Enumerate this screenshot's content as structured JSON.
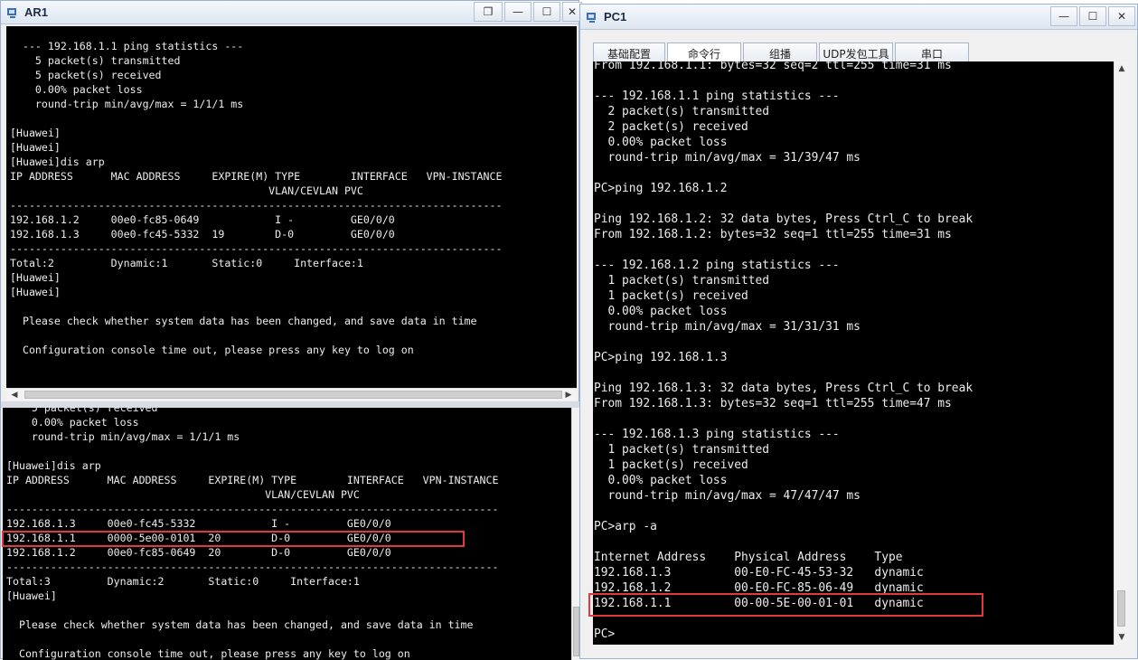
{
  "ar1": {
    "title": "AR1",
    "buttons": {
      "restore": "❐",
      "minimize": "—",
      "maximize": "☐",
      "close": "✕"
    },
    "top_console": [
      "  --- 192.168.1.1 ping statistics ---",
      "    5 packet(s) transmitted",
      "    5 packet(s) received",
      "    0.00% packet loss",
      "    round-trip min/avg/max = 1/1/1 ms",
      "",
      "[Huawei]",
      "[Huawei]",
      "[Huawei]dis arp",
      "IP ADDRESS      MAC ADDRESS     EXPIRE(M) TYPE        INTERFACE   VPN-INSTANCE",
      "                                         VLAN/CEVLAN PVC",
      "------------------------------------------------------------------------------",
      "192.168.1.2     00e0-fc85-0649            I -         GE0/0/0",
      "192.168.1.3     00e0-fc45-5332  19        D-0         GE0/0/0",
      "------------------------------------------------------------------------------",
      "Total:2         Dynamic:1       Static:0     Interface:1",
      "[Huawei]",
      "[Huawei]",
      "",
      "  Please check whether system data has been changed, and save data in time",
      "",
      "  Configuration console time out, please press any key to log on"
    ],
    "bottom_console": [
      "    5 packet(s) received",
      "    0.00% packet loss",
      "    round-trip min/avg/max = 1/1/1 ms",
      "",
      "[Huawei]dis arp",
      "IP ADDRESS      MAC ADDRESS     EXPIRE(M) TYPE        INTERFACE   VPN-INSTANCE",
      "                                         VLAN/CEVLAN PVC",
      "------------------------------------------------------------------------------",
      "192.168.1.3     00e0-fc45-5332            I -         GE0/0/0",
      "192.168.1.1     0000-5e00-0101  20        D-0         GE0/0/0",
      "192.168.1.2     00e0-fc85-0649  20        D-0         GE0/0/0",
      "------------------------------------------------------------------------------",
      "Total:3         Dynamic:2       Static:0     Interface:1",
      "[Huawei]",
      "",
      "  Please check whether system data has been changed, and save data in time",
      "",
      "  Configuration console time out, please press any key to log on"
    ]
  },
  "pc1": {
    "title": "PC1",
    "buttons": {
      "minimize": "—",
      "maximize": "☐",
      "close": "✕"
    },
    "tabs": [
      "基础配置",
      "命令行",
      "组播",
      "UDP发包工具",
      "串口"
    ],
    "active_tab": "命令行",
    "console": [
      "From 192.168.1.1: bytes=32 seq=2 ttl=255 time=31 ms",
      "",
      "--- 192.168.1.1 ping statistics ---",
      "  2 packet(s) transmitted",
      "  2 packet(s) received",
      "  0.00% packet loss",
      "  round-trip min/avg/max = 31/39/47 ms",
      "",
      "PC>ping 192.168.1.2",
      "",
      "Ping 192.168.1.2: 32 data bytes, Press Ctrl_C to break",
      "From 192.168.1.2: bytes=32 seq=1 ttl=255 time=31 ms",
      "",
      "--- 192.168.1.2 ping statistics ---",
      "  1 packet(s) transmitted",
      "  1 packet(s) received",
      "  0.00% packet loss",
      "  round-trip min/avg/max = 31/31/31 ms",
      "",
      "PC>ping 192.168.1.3",
      "",
      "Ping 192.168.1.3: 32 data bytes, Press Ctrl_C to break",
      "From 192.168.1.3: bytes=32 seq=1 ttl=255 time=47 ms",
      "",
      "--- 192.168.1.3 ping statistics ---",
      "  1 packet(s) transmitted",
      "  1 packet(s) received",
      "  0.00% packet loss",
      "  round-trip min/avg/max = 47/47/47 ms",
      "",
      "PC>arp -a",
      "",
      "Internet Address    Physical Address    Type",
      "192.168.1.3         00-E0-FC-45-53-32   dynamic",
      "192.168.1.2         00-E0-FC-85-06-49   dynamic",
      "192.168.1.1         00-00-5E-00-01-01   dynamic",
      "",
      "PC>"
    ]
  },
  "colors": {
    "terminal_bg": "#000000",
    "terminal_fg": "#ececec",
    "highlight": "#e0393e",
    "titlebar": "#dde6f1"
  },
  "icons": [
    "ensp-app-icon",
    "restore-icon",
    "minimize-icon",
    "maximize-icon",
    "close-icon",
    "scroll-left-icon",
    "scroll-right-icon",
    "scroll-up-icon",
    "scroll-down-icon"
  ]
}
